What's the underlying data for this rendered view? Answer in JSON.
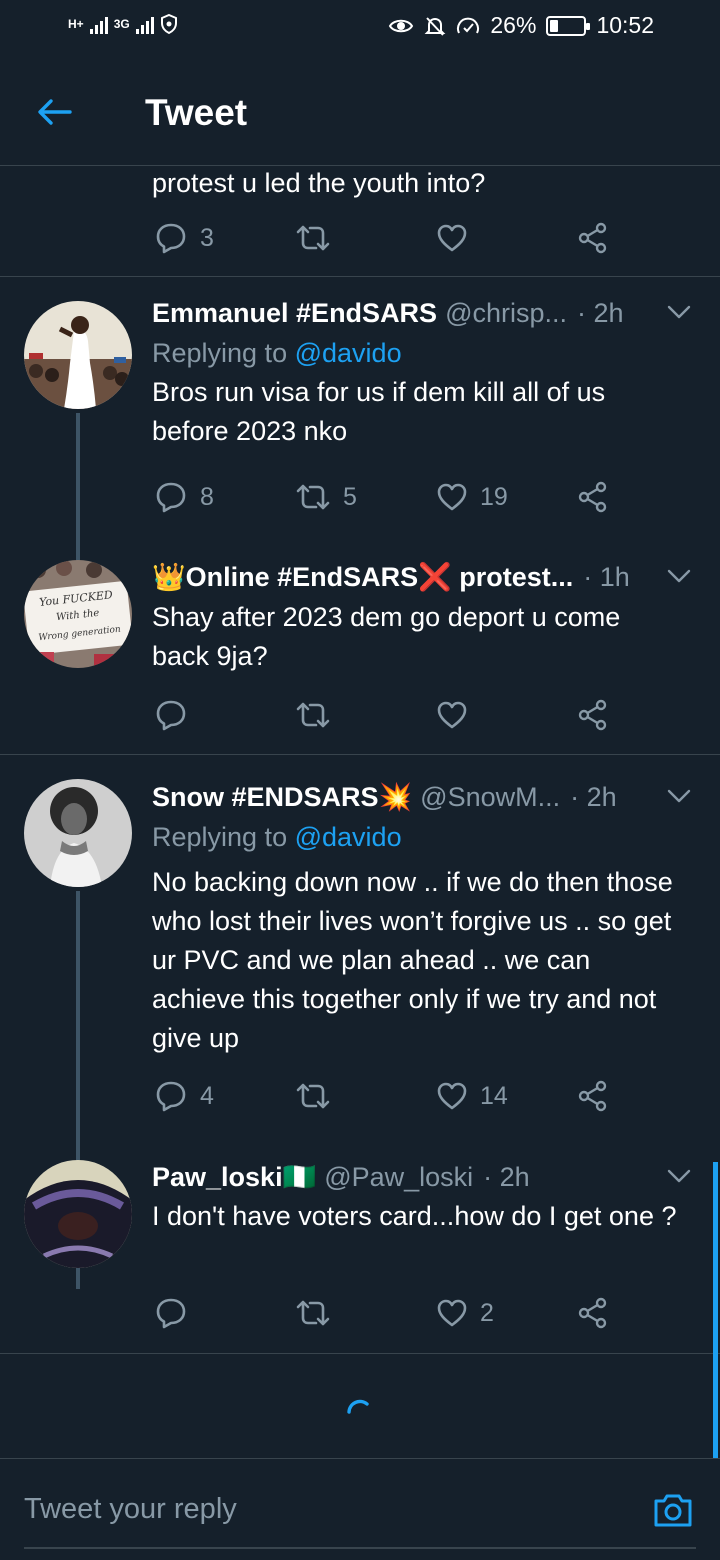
{
  "status_bar": {
    "net1": "H+",
    "net2": "3G",
    "battery": "26%",
    "battery_level": 0.26,
    "time": "10:52"
  },
  "header": {
    "title": "Tweet"
  },
  "partial_tweet": {
    "text": "protest u led the youth into?",
    "reply_count": "3",
    "retweet_count": "",
    "like_count": ""
  },
  "tweets": [
    {
      "name": "Emmanuel #EndSARS",
      "handle": "@chrisp...",
      "time": "· 2h",
      "replying_prefix": "Replying to",
      "replying_to": "@davido",
      "body": "Bros run visa for us if dem kill all of us before 2023 nko",
      "reply_count": "8",
      "retweet_count": "5",
      "like_count": "19"
    },
    {
      "name": "👑Online #EndSARS❌ protest...",
      "handle": "",
      "time": "· 1h",
      "body": "Shay after 2023 dem go deport u come back 9ja?",
      "reply_count": "",
      "retweet_count": "",
      "like_count": "",
      "avatar_sign": "You FUCKED With the Wrong generation"
    },
    {
      "name": "Snow #ENDSARS💥",
      "handle": "@SnowM...",
      "time": "· 2h",
      "replying_prefix": "Replying to",
      "replying_to": "@davido",
      "body": "No backing down now .. if we do then those who lost their lives won’t forgive us .. so get ur PVC and we plan ahead .. we can achieve this together only if we try and not give up",
      "reply_count": "4",
      "retweet_count": "",
      "like_count": "14"
    },
    {
      "name": "Paw_loski🇳🇬",
      "handle": "@Paw_loski",
      "time": "· 2h",
      "body": "I don't have voters card...how do I get one ?",
      "reply_count": "",
      "retweet_count": "",
      "like_count": "2"
    }
  ],
  "composer": {
    "placeholder": "Tweet your reply"
  },
  "colors": {
    "background": "#15202b",
    "accent": "#1da1f2",
    "muted": "#8899a6",
    "divider": "#38444d"
  }
}
